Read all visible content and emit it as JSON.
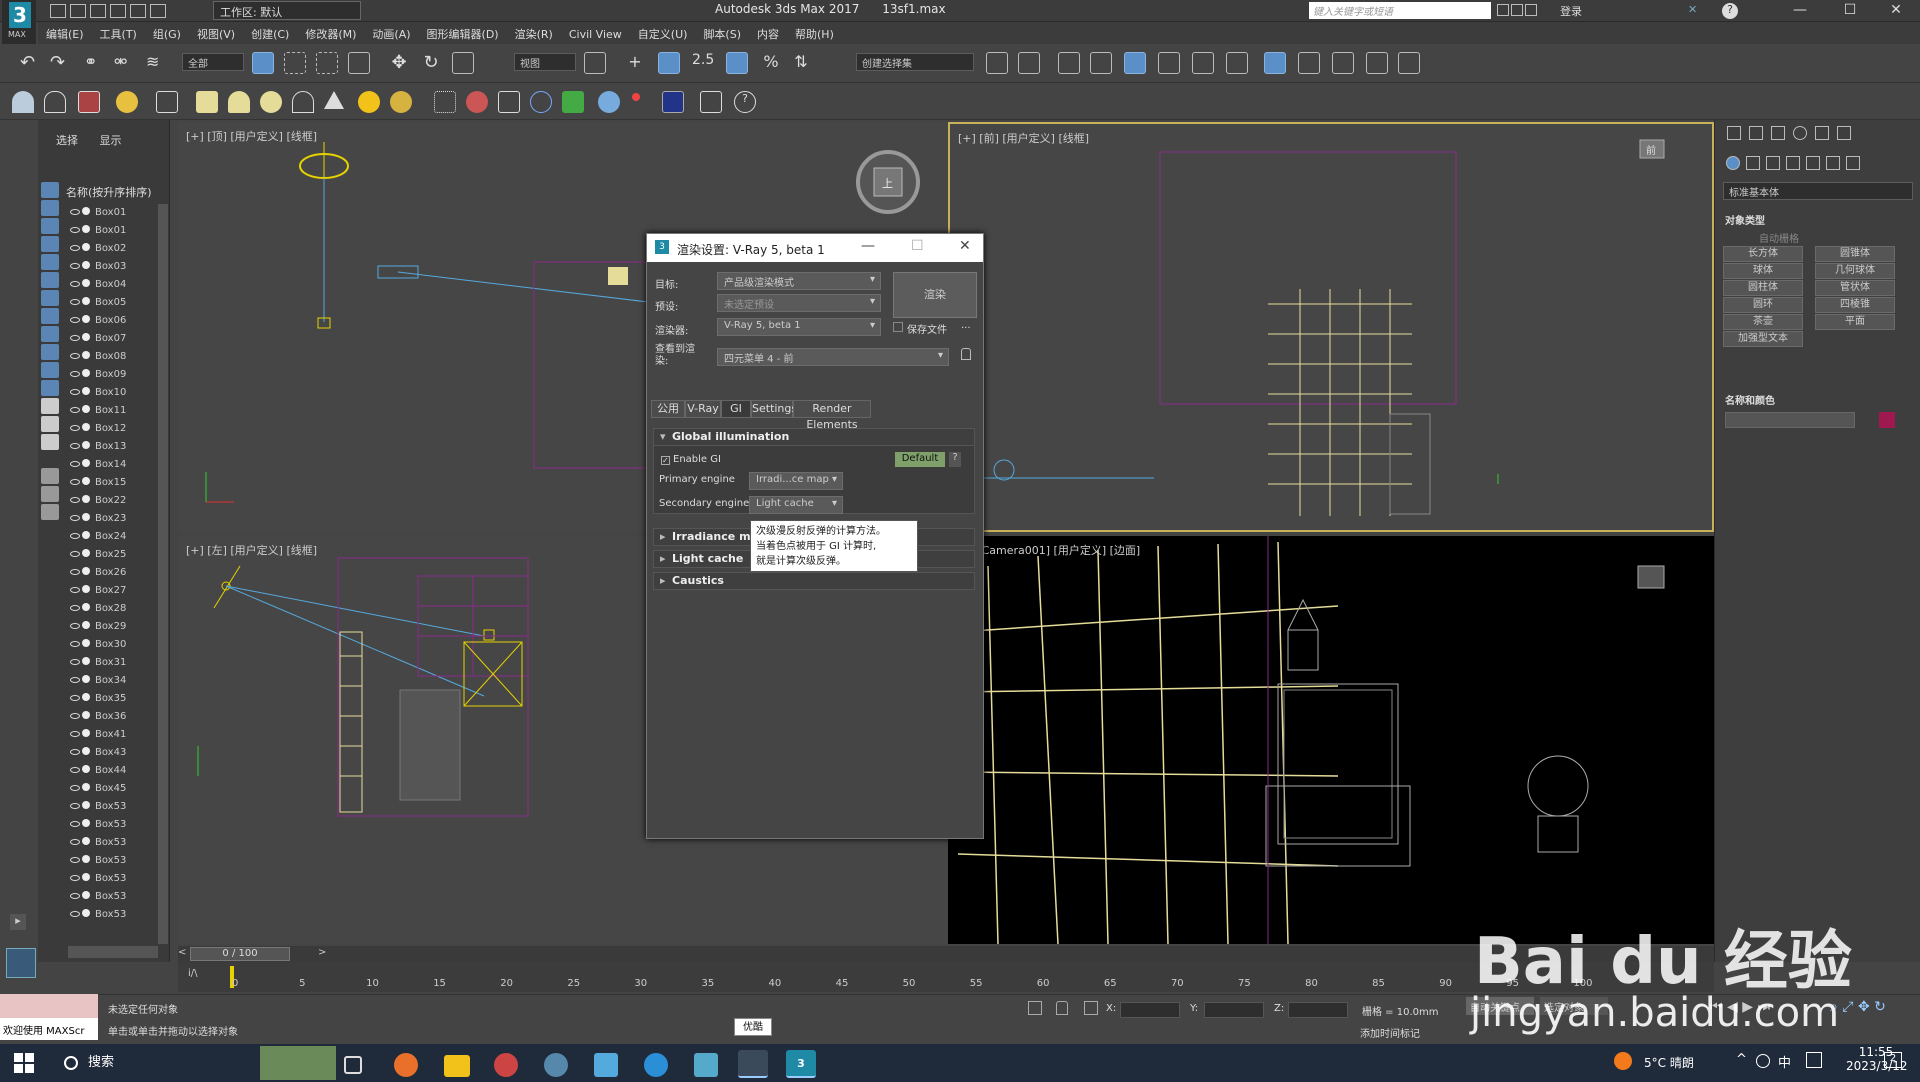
{
  "app": {
    "logo_text": "3",
    "logo_sub": "MAX",
    "workspace": "工作区: 默认",
    "title": "Autodesk 3ds Max 2017",
    "file": "13sf1.max",
    "search_placeholder": "键入关键字或短语",
    "login": "登录"
  },
  "menu": [
    "编辑(E)",
    "工具(T)",
    "组(G)",
    "视图(V)",
    "创建(C)",
    "修改器(M)",
    "动画(A)",
    "图形编辑器(D)",
    "渲染(R)",
    "Civil View",
    "自定义(U)",
    "脚本(S)",
    "内容",
    "帮助(H)"
  ],
  "toolbar": {
    "filter": "全部",
    "ref_coord": "视图",
    "selection_set": "创建选择集"
  },
  "explorer": {
    "tabs": [
      "选择",
      "显示"
    ],
    "column_header": "名称(按升序排序)",
    "items": [
      "Box01",
      "Box01",
      "Box02",
      "Box03",
      "Box04",
      "Box05",
      "Box06",
      "Box07",
      "Box08",
      "Box09",
      "Box10",
      "Box11",
      "Box12",
      "Box13",
      "Box14",
      "Box15",
      "Box22",
      "Box23",
      "Box24",
      "Box25",
      "Box26",
      "Box27",
      "Box28",
      "Box29",
      "Box30",
      "Box31",
      "Box34",
      "Box35",
      "Box36",
      "Box41",
      "Box43",
      "Box44",
      "Box45",
      "Box53",
      "Box53",
      "Box53",
      "Box53",
      "Box53",
      "Box53",
      "Box53"
    ]
  },
  "viewports": {
    "top_left": "[+] [顶] [用户定义] [线框]",
    "top_right": "[+] [前] [用户定义] [线框]",
    "bottom_left": "[+] [左] [用户定义] [线框]",
    "bottom_right": "[+] [Camera001] [用户定义] [边面]",
    "viewcube_label": "上",
    "viewcube_front": "前"
  },
  "render_dialog": {
    "title": "渲染设置: V-Ray 5, beta 1",
    "target_label": "目标:",
    "target_value": "产品级渲染模式",
    "preset_label": "预设:",
    "preset_value": "未选定预设",
    "renderer_label": "渲染器:",
    "renderer_value": "V-Ray 5, beta 1",
    "save_file_label": "保存文件",
    "view_label": "查看到渲染:",
    "view_value": "四元菜单 4 - 前",
    "render_button": "渲染",
    "tabs": [
      "公用",
      "V-Ray",
      "GI",
      "Settings",
      "Render Elements"
    ],
    "gi_rollout": "Global illumination",
    "enable_gi": "Enable GI",
    "default_button": "Default",
    "help_button": "?",
    "primary_engine_label": "Primary engine",
    "primary_engine_value": "Irradi...ce map",
    "secondary_engine_label": "Secondary engine",
    "secondary_engine_value": "Light cache",
    "rollout_irradiance": "Irradiance ma",
    "rollout_lightcache": "Light cache",
    "rollout_caustics": "Caustics",
    "tooltip_lines": [
      "次级漫反射反弹的计算方法。",
      "当着色点被用于 GI 计算时,",
      "就是计算次级反弹。"
    ]
  },
  "command_panel": {
    "dropdown": "标准基本体",
    "object_type_header": "对象类型",
    "autogrid": "自动栅格",
    "buttons": [
      "长方体",
      "圆锥体",
      "球体",
      "几何球体",
      "圆柱体",
      "管状体",
      "圆环",
      "四棱锥",
      "茶壶",
      "平面",
      "加强型文本"
    ],
    "name_color_header": "名称和颜色",
    "color": "#a01850"
  },
  "timeline": {
    "frame": "0 / 100",
    "ticks": [
      "0",
      "5",
      "10",
      "15",
      "20",
      "25",
      "30",
      "35",
      "40",
      "45",
      "50",
      "55",
      "60",
      "65",
      "70",
      "75",
      "80",
      "85",
      "90",
      "95",
      "100"
    ]
  },
  "status": {
    "welcome": "欢迎使用 MAXScr",
    "line1": "未选定任何对象",
    "line2": "单击或单击并拖动以选择对象",
    "x_label": "X:",
    "y_label": "Y:",
    "z_label": "Z:",
    "grid": "栅格 = 10.0mm",
    "add_time_tag": "添加时间标记",
    "auto_key": "自动关键点",
    "selected": "选定对象",
    "popup": "优酷"
  },
  "taskbar": {
    "search": "搜索",
    "weather": "5°C 晴朗",
    "ime": "中",
    "time": "11:55",
    "date": "2023/3/12",
    "notify": "2"
  },
  "watermark": {
    "brand": "Bai du 经验",
    "url": "jingyan.baidu.com"
  }
}
